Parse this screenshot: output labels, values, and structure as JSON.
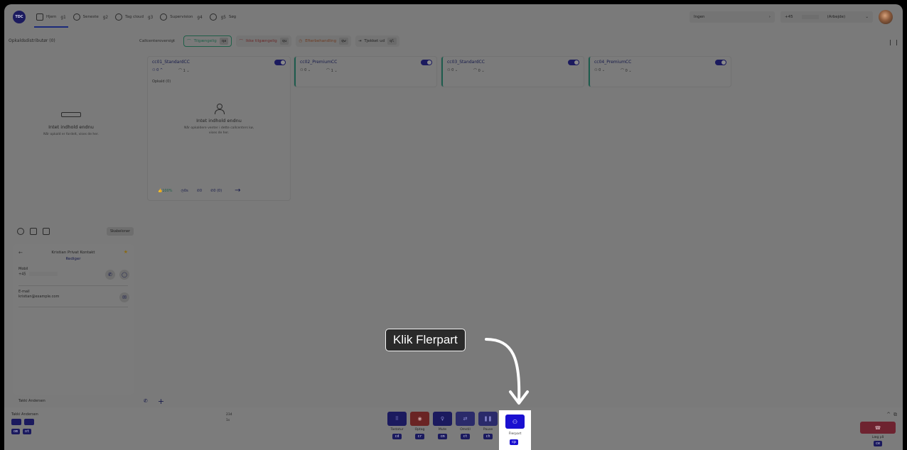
{
  "topbar": {
    "logo": "TDC",
    "nav": [
      {
        "label": "Hjem",
        "key": "g1",
        "icon": "home-icon"
      },
      {
        "label": "Seneste",
        "key": "g2",
        "icon": "phone-icon"
      },
      {
        "label": "Tag cloud",
        "key": "g3",
        "icon": "cloud-icon"
      },
      {
        "label": "Supervision",
        "key": "g4",
        "icon": "people-icon"
      },
      {
        "label": "Søg",
        "key": "g5",
        "icon": "search-icon"
      }
    ],
    "status": "Ingen",
    "phone_prefix": "+45",
    "phone_type": "(Arbejde)"
  },
  "left_panel": {
    "title": "Opkaldsdistributør (0)",
    "empty_title": "Intet indhold endnu",
    "empty_sub": "Når opkald er fordelt, vises de her."
  },
  "overview": {
    "label": "Callcenteroversigt",
    "filters": [
      {
        "label": "Tilgængelig",
        "key": "qa"
      },
      {
        "label": "Ikke tilgængelig",
        "key": "qu"
      },
      {
        "label": "Efterbehandling",
        "key": "qw"
      },
      {
        "label": "Tjekket ud",
        "key": "ql"
      }
    ]
  },
  "cards": [
    {
      "name": "cc01_StandardCC",
      "agents": "0",
      "available": "1",
      "calls": "Opkald (0)",
      "empty_title": "Intet indhold endnu",
      "empty_sub": "Når opkaldere venter i dette callcenters kø, vises de her.",
      "stat_pct": "100%",
      "stat_time": "0s",
      "stat_calls": "0",
      "stat_missed": "0 (0)"
    },
    {
      "name": "cc02_PremiumCC",
      "agents": "0",
      "available": "1"
    },
    {
      "name": "cc03_StandardCC",
      "agents": "0",
      "available": "0"
    },
    {
      "name": "cc04_PremiumCC",
      "agents": "0",
      "available": "0"
    }
  ],
  "contact": {
    "templates": "Skabeloner",
    "name": "Kristian Privat Kontakt",
    "edit": "Rediger",
    "mobile_label": "Mobil",
    "mobile_prefix": "+45",
    "email_label": "E-mail",
    "email": "kristian@example.com"
  },
  "chat_tab": "Takki Andersen",
  "bottombar": {
    "caller": "Takki Andersen",
    "mini_keys": [
      "om",
      "ot"
    ],
    "call_number": "234",
    "call_time": "1s",
    "controls": [
      {
        "label": "Tastatur",
        "key": "cd",
        "icon": "keypad-icon"
      },
      {
        "label": "Optag",
        "key": "cr",
        "icon": "record-icon"
      },
      {
        "label": "Mute",
        "key": "cm",
        "icon": "mic-icon"
      },
      {
        "label": "Omstil",
        "key": "ct",
        "icon": "transfer-icon"
      },
      {
        "label": "Pause",
        "key": "ch",
        "icon": "pause-icon"
      }
    ],
    "multiparty": {
      "label": "Flerpart",
      "key": "cp"
    },
    "hangup": {
      "label": "Læg på",
      "key": "ce"
    }
  },
  "tooltip": "Klik Flerpart"
}
